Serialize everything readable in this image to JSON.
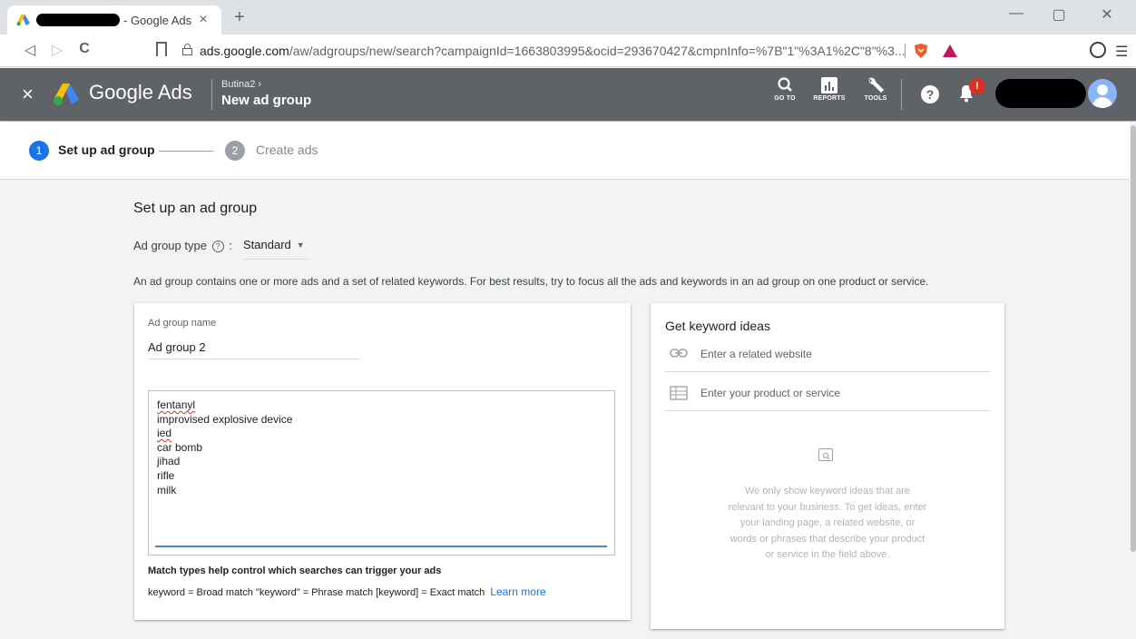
{
  "browser": {
    "tab_title": "- Google Ads",
    "tab_close": "×",
    "new_tab": "+",
    "url_host": "ads.google.com",
    "url_path": "/aw/adgroups/new/search?campaignId=1663803995&ocid=293670427&cmpnInfo=%7B\"1\"%3A1%2C\"8\"%3...",
    "nav_back": "◁",
    "nav_forward": "▷",
    "nav_reload": "C",
    "win_minimize": "—",
    "win_restore": "▢",
    "win_close": "✕",
    "menu": "☰"
  },
  "header": {
    "close": "×",
    "brand": "Google Ads",
    "breadcrumb": "Butina2  ›",
    "title": "New ad group",
    "goto_label": "GO TO",
    "reports_label": "REPORTS",
    "tools_label": "TOOLS",
    "help": "?",
    "notification_badge": "!"
  },
  "stepper": {
    "steps": [
      {
        "num": "1",
        "label": "Set up ad group"
      },
      {
        "num": "2",
        "label": "Create ads"
      }
    ]
  },
  "form": {
    "section_title": "Set up an ad group",
    "ad_group_type_label": "Ad group type",
    "ad_group_type_sep": ":",
    "ad_group_type_value": "Standard",
    "description": "An ad group contains one or more ads and a set of related keywords. For best results, try to focus all the ads and keywords in an ad group on one product or service.",
    "ad_group_name_label": "Ad group name",
    "ad_group_name_value": "Ad group 2",
    "keywords": [
      "fentanyl",
      "improvised explosive device",
      "ied",
      "car bomb",
      "jihad",
      "rifle",
      "milk"
    ],
    "match_types_title": "Match types help control which searches can trigger your ads",
    "match_types_desc": "keyword = Broad match  \"keyword\" = Phrase match  [keyword] = Exact match",
    "learn_more": "Learn more"
  },
  "keyword_ideas": {
    "title": "Get keyword ideas",
    "website_placeholder": "Enter a related website",
    "product_placeholder": "Enter your product or service",
    "empty_text": "We only show keyword ideas that are relevant to your business. To get ideas, enter your landing page, a related website, or words or phrases that describe your product or service in the field above."
  },
  "colors": {
    "header_bg": "#5f6368",
    "step_active": "#1a73e8",
    "step_inactive": "#9aa0a6",
    "link": "#1a73e8",
    "alert": "#d93025"
  }
}
